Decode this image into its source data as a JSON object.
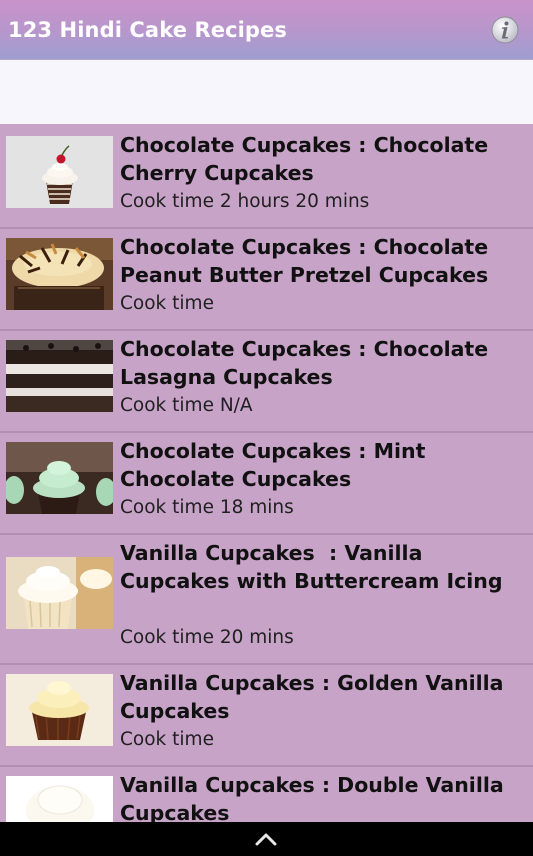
{
  "app": {
    "title": "123 Hindi Cake Recipes",
    "info_icon": "info-icon",
    "accent": "#c7a3c8"
  },
  "recipes": [
    {
      "name": "Chocolate Cupcakes : Chocolate Cherry Cupcakes",
      "cook_time": "Cook time 2 hours 20 mins"
    },
    {
      "name": "Chocolate Cupcakes : Chocolate Peanut Butter Pretzel Cupcakes",
      "cook_time": "Cook time"
    },
    {
      "name": "Chocolate Cupcakes : Chocolate Lasagna Cupcakes",
      "cook_time": "Cook time N/A"
    },
    {
      "name": "Chocolate Cupcakes : Mint Chocolate Cupcakes",
      "cook_time": "Cook time 18 mins"
    },
    {
      "name": "Vanilla Cupcakes  : Vanilla Cupcakes with Buttercream Icing",
      "cook_time": "Cook time 20 mins"
    },
    {
      "name": "Vanilla Cupcakes : Golden Vanilla Cupcakes",
      "cook_time": "Cook time"
    },
    {
      "name": "Vanilla Cupcakes : Double Vanilla Cupcakes",
      "cook_time": ""
    }
  ],
  "navbar": {
    "icon": "chevron-up-icon"
  }
}
